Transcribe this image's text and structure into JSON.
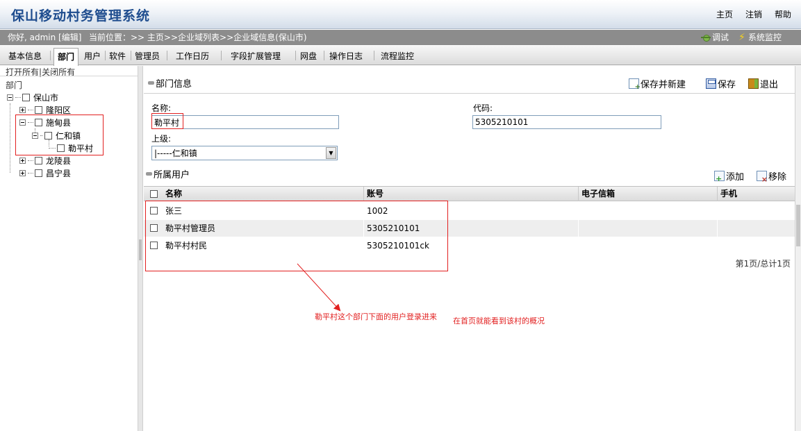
{
  "header": {
    "title": "保山移动村务管理系统",
    "links": [
      "主页",
      "注销",
      "帮助"
    ]
  },
  "infobar": {
    "greeting": "你好, admin [编辑]",
    "location": "当前位置：>> 主页>>企业域列表>>企业域信息(保山市)",
    "debug_label": "调试",
    "monitor_label": "系统监控"
  },
  "tabs": [
    "基本信息",
    "部门",
    "用户",
    "软件",
    "管理员",
    "工作日历",
    "字段扩展管理",
    "网盘",
    "操作日志",
    "流程监控"
  ],
  "tree": {
    "expand_all": "打开所有",
    "separator": "|",
    "collapse_all": "关闭所有",
    "caption": "部门",
    "nodes": [
      "保山市",
      "隆阳区",
      "施甸县",
      "仁和镇",
      "勒平村",
      "龙陵县",
      "昌宁县"
    ]
  },
  "dept_info": {
    "title": "部门信息",
    "save_new": "保存并新建",
    "save": "保存",
    "exit": "退出",
    "name_label": "名称:",
    "name_value": "勒平村",
    "code_label": "代码:",
    "code_value": "5305210101",
    "parent_label": "上级:",
    "parent_value": "|-----仁和镇"
  },
  "users": {
    "title": "所属用户",
    "add": "添加",
    "remove": "移除",
    "columns": [
      "名称",
      "账号",
      "电子信箱",
      "手机"
    ],
    "rows": [
      {
        "name": "张三",
        "account": "1002",
        "email": "",
        "phone": ""
      },
      {
        "name": "勒平村管理员",
        "account": "5305210101",
        "email": "",
        "phone": ""
      },
      {
        "name": "勒平村村民",
        "account": "5305210101ck",
        "email": "",
        "phone": ""
      }
    ],
    "pager": "第1页/总计1页"
  },
  "annotation": {
    "text1": "勒平村这个部门下面的用户登录进来",
    "text2": "在首页就能看到该村的概况",
    "color": "#e21f1f"
  }
}
